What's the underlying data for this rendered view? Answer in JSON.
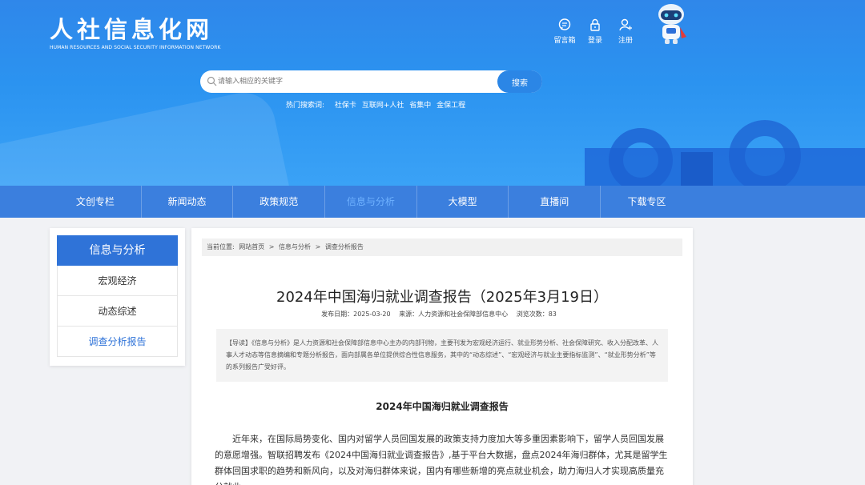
{
  "header": {
    "logo_cn": "人社信息化网",
    "logo_en": "HUMAN RESOURCES AND SOCIAL SECURITY INFORMATION NETWORK",
    "tools": [
      {
        "label": "留言箱",
        "icon": "message-icon"
      },
      {
        "label": "登录",
        "icon": "lock-icon"
      },
      {
        "label": "注册",
        "icon": "user-add-icon"
      }
    ],
    "search": {
      "placeholder": "请输入相应的关键字",
      "button": "搜索"
    },
    "hot": {
      "label": "热门搜索词:",
      "items": [
        "社保卡",
        "互联网+人社",
        "省集中",
        "金保工程"
      ]
    }
  },
  "nav": {
    "items": [
      "文创专栏",
      "新闻动态",
      "政策规范",
      "信息与分析",
      "大模型",
      "直播间",
      "下载专区"
    ],
    "active": "信息与分析"
  },
  "sidebar": {
    "title": "信息与分析",
    "items": [
      "宏观经济",
      "动态综述",
      "调查分析报告"
    ],
    "active": "调查分析报告"
  },
  "article": {
    "breadcrumb": {
      "prefix": "当前位置:",
      "items": [
        "网站首页",
        "信息与分析",
        "调查分析报告"
      ],
      "sep": ">"
    },
    "title": "2024年中国海归就业调查报告（2025年3月19日）",
    "meta": {
      "date": "发布日期：2025-03-20",
      "source": "来源：人力资源和社会保障部信息中心",
      "views": "浏览次数：83"
    },
    "intro": "【导读】《信息与分析》是人力资源和社会保障部信息中心主办的内部刊物，主要刊发为宏观经济运行、就业形势分析、社会保障研究、收入分配改革、人事人才动态等信息摘编和专题分析报告，面向部属各单位提供综合性信息服务，其中的“动态综述”、“宏观经济与就业主要指标监测”、“就业形势分析”等的系列报告广受好评。",
    "subtitle": "2024年中国海归就业调查报告",
    "body": "近年来，在国际局势变化、国内对留学人员回国发展的政策支持力度加大等多重因素影响下，留学人员回国发展的意愿增强。智联招聘发布《2024中国海归就业调查报告》,基于平台大数据，盘点2024年海归群体，尤其是留学生群体回国求职的趋势和新风向，以及对海归群体来说，国内有哪些新增的亮点就业机会，助力海归人才实现高质量充分就业。"
  }
}
